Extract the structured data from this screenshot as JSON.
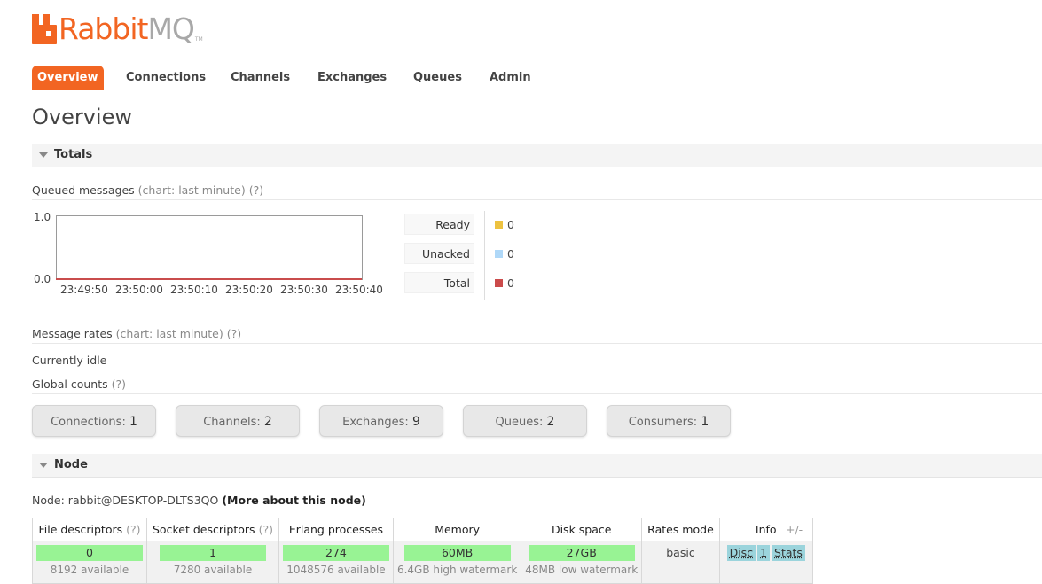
{
  "logo": {
    "rabbit": "Rabbit",
    "mq": "MQ",
    "tm": "TM"
  },
  "tabs": [
    {
      "label": "Overview"
    },
    {
      "label": "Connections"
    },
    {
      "label": "Channels"
    },
    {
      "label": "Exchanges"
    },
    {
      "label": "Queues"
    },
    {
      "label": "Admin"
    }
  ],
  "page_title": "Overview",
  "totals": {
    "title": "Totals",
    "queued_label": "Queued messages",
    "queued_chart_note": "(chart: last minute)",
    "help": "(?)",
    "chart": {
      "y_max": "1.0",
      "y_min": "0.0",
      "x_ticks": [
        "23:49:50",
        "23:50:00",
        "23:50:10",
        "23:50:20",
        "23:50:30",
        "23:50:40"
      ]
    },
    "legend": [
      {
        "label": "Ready",
        "value": "0",
        "color": "#edc240"
      },
      {
        "label": "Unacked",
        "value": "0",
        "color": "#afd8f8"
      },
      {
        "label": "Total",
        "value": "0",
        "color": "#cb4b4b"
      }
    ],
    "rates_label": "Message rates",
    "rates_chart_note": "(chart: last minute)",
    "idle_text": "Currently idle",
    "global_label": "Global counts",
    "counts": [
      {
        "label": "Connections:",
        "value": "1"
      },
      {
        "label": "Channels:",
        "value": "2"
      },
      {
        "label": "Exchanges:",
        "value": "9"
      },
      {
        "label": "Queues:",
        "value": "2"
      },
      {
        "label": "Consumers:",
        "value": "1"
      }
    ]
  },
  "node": {
    "title": "Node",
    "node_prefix": "Node: rabbit@DESKTOP-DLTS3QO",
    "more_link": "(More about this node)",
    "headers": {
      "file": "File descriptors",
      "socket": "Socket descriptors",
      "erlang": "Erlang processes",
      "memory": "Memory",
      "disk": "Disk space",
      "rates": "Rates mode",
      "info": "Info"
    },
    "file": {
      "value": "0",
      "sub": "8192 available"
    },
    "socket": {
      "value": "1",
      "sub": "7280 available"
    },
    "erlang": {
      "value": "274",
      "sub": "1048576 available"
    },
    "memory": {
      "value": "60MB",
      "sub": "6.4GB high watermark"
    },
    "disk": {
      "value": "27GB",
      "sub": "48MB low watermark"
    },
    "rates_mode": "basic",
    "info_tags": [
      "Disc",
      "1",
      "Stats"
    ],
    "plus_minus": "+/-"
  }
}
